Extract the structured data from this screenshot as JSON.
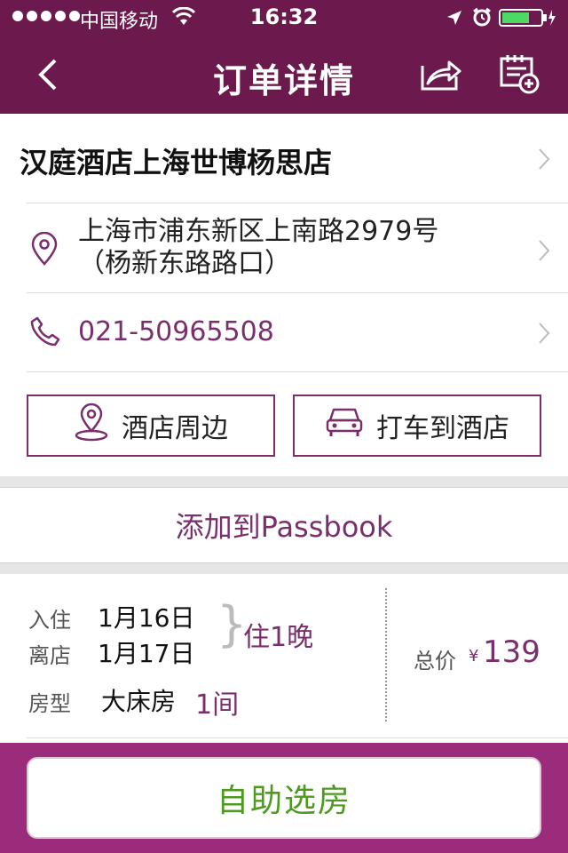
{
  "status_bar": {
    "carrier": "中国移动",
    "time": "16:32"
  },
  "nav": {
    "title": "订单详情"
  },
  "hotel": {
    "name": "汉庭酒店上海世博杨思店",
    "address_line1": "上海市浦东新区上南路2979号",
    "address_line2": "（杨新东路路口）",
    "phone": "021-50965508"
  },
  "actions": {
    "nearby_label": "酒店周边",
    "taxi_label": "打车到酒店"
  },
  "passbook": {
    "label": "添加到Passbook"
  },
  "booking": {
    "checkin_label": "入住",
    "checkin_date": "1月16日",
    "checkout_label": "离店",
    "checkout_date": "1月17日",
    "nights": "住1晚",
    "room_type_label": "房型",
    "room_type": "大床房",
    "room_count": "1间",
    "total_label": "总价",
    "currency": "¥",
    "total_price": "139"
  },
  "bottom": {
    "select_room_label": "自助选房"
  },
  "colors": {
    "brand": "#6c1a4e",
    "accent": "#7a2e6c",
    "bottom_bar": "#9b2c7c",
    "green": "#4e9a1e"
  },
  "icons": [
    "signal-dots-icon",
    "wifi-icon",
    "location-arrow-icon",
    "alarm-icon",
    "battery-icon",
    "back-chevron-icon",
    "share-icon",
    "add-calendar-icon",
    "map-pin-icon",
    "phone-icon",
    "chevron-right-icon",
    "car-icon"
  ]
}
